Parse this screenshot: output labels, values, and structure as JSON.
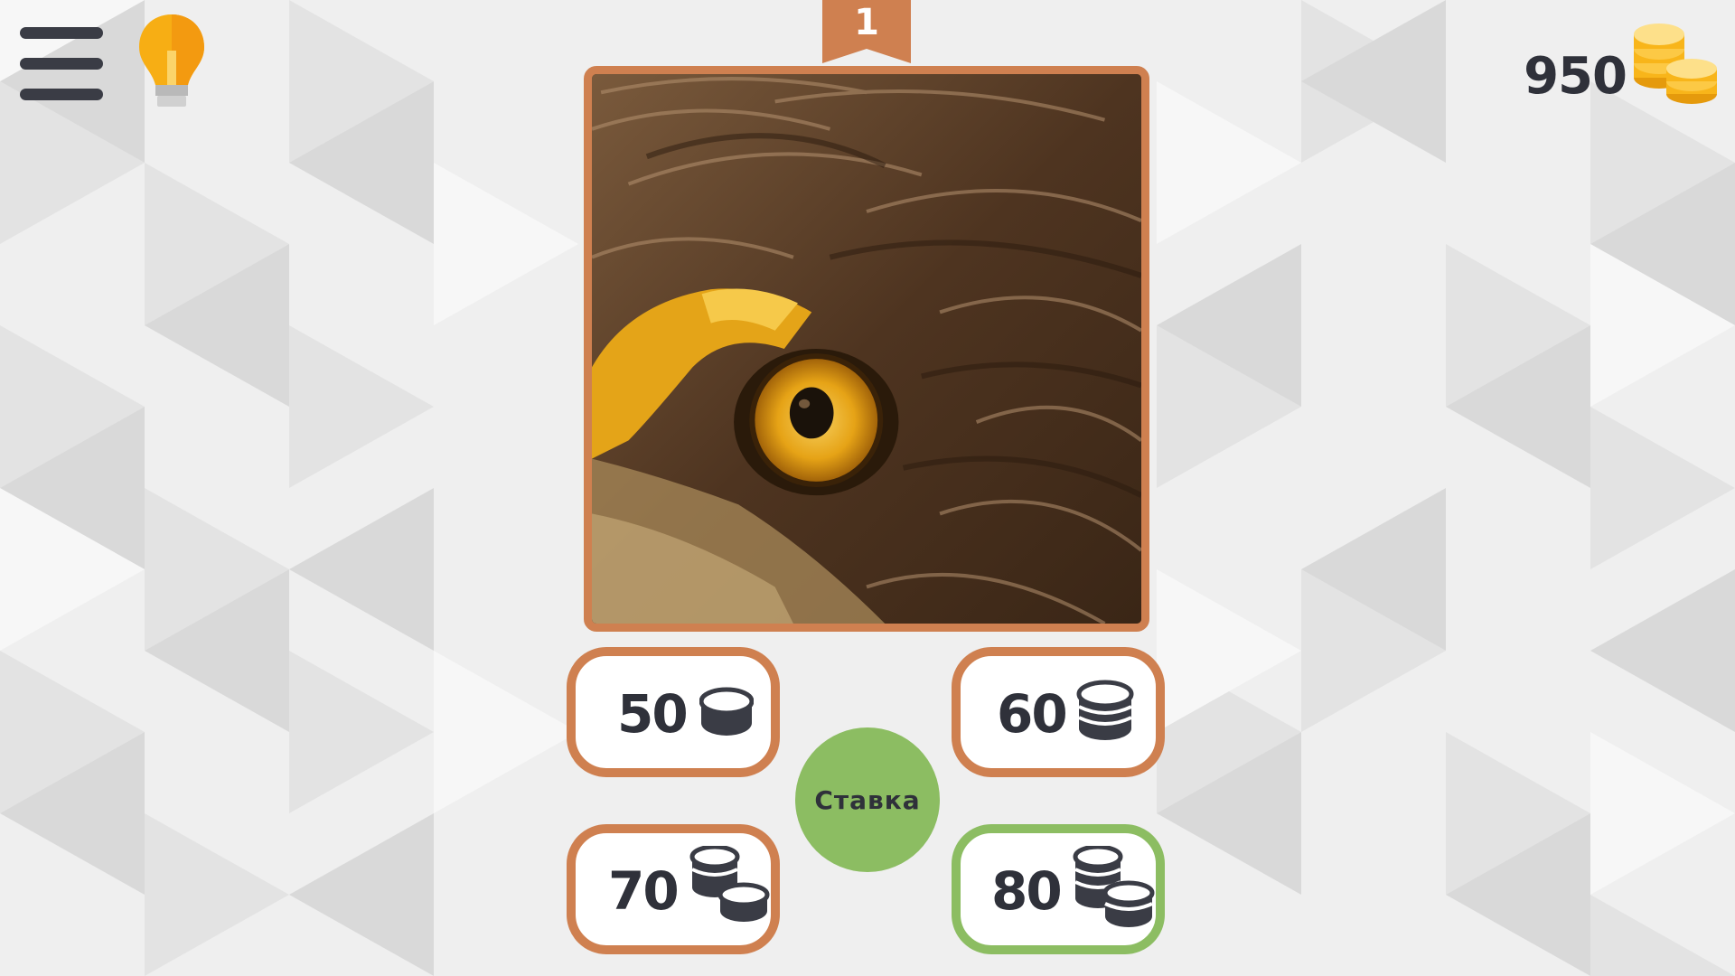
{
  "game": {
    "level": "1",
    "coins": "950",
    "stake_label": "Ставка",
    "bets": [
      {
        "value": "50",
        "icon": "coin-single-icon",
        "selected": false
      },
      {
        "value": "60",
        "icon": "coin-stack-small-icon",
        "selected": false
      },
      {
        "value": "70",
        "icon": "coin-stacks-icon",
        "selected": false
      },
      {
        "value": "80",
        "icon": "coin-stacks-large-icon",
        "selected": true
      }
    ]
  },
  "icons": {
    "menu": "menu-icon",
    "hint": "lightbulb-icon",
    "coins": "gold-coins-icon"
  },
  "colors": {
    "frame": "#cf8050",
    "selected": "#8cbd62",
    "stake_button": "#8cbd62",
    "text_dark": "#2f313a",
    "hint": "#f7ae14",
    "coin_gold": "#f8b51a"
  }
}
